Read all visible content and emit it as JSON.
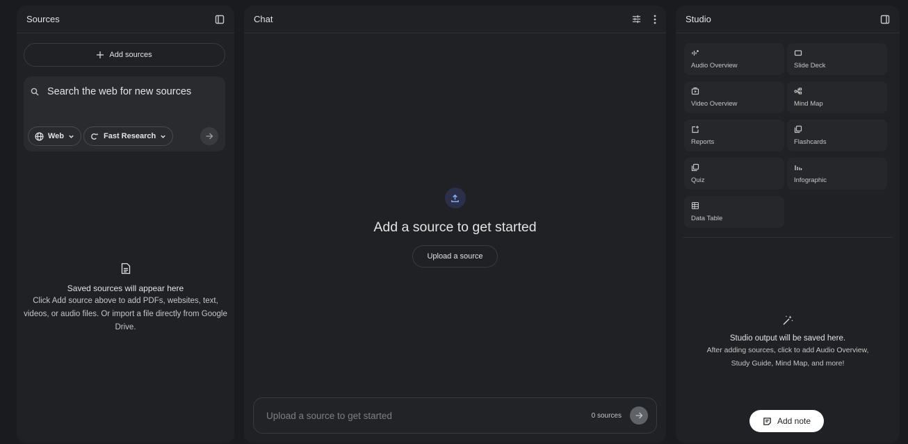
{
  "sources": {
    "title": "Sources",
    "add_label": "Add sources",
    "search_placeholder": "Search the web for new sources",
    "web_chip": "Web",
    "research_chip": "Fast Research",
    "empty_title": "Saved sources will appear here",
    "empty_desc": "Click Add source above to add PDFs, websites, text, videos, or audio files. Or import a file directly from Google Drive."
  },
  "chat": {
    "title": "Chat",
    "empty_title": "Add a source to get started",
    "upload_label": "Upload a source",
    "input_placeholder": "Upload a source to get started",
    "source_count": "0 sources"
  },
  "studio": {
    "title": "Studio",
    "tiles": [
      {
        "label": "Audio Overview",
        "icon": "audio-overview-icon"
      },
      {
        "label": "Slide Deck",
        "icon": "slide-deck-icon"
      },
      {
        "label": "Video Overview",
        "icon": "video-overview-icon"
      },
      {
        "label": "Mind Map",
        "icon": "mind-map-icon"
      },
      {
        "label": "Reports",
        "icon": "reports-icon"
      },
      {
        "label": "Flashcards",
        "icon": "flashcards-icon"
      },
      {
        "label": "Quiz",
        "icon": "quiz-icon"
      },
      {
        "label": "Infographic",
        "icon": "infographic-icon"
      },
      {
        "label": "Data Table",
        "icon": "data-table-icon"
      }
    ],
    "empty_title": "Studio output will be saved here.",
    "empty_desc_1": "After adding sources, click to add Audio Overview,",
    "empty_desc_2": "Study Guide, Mind Map, and more!",
    "add_note_label": "Add note"
  },
  "colors": {
    "background": "#1a1b1e",
    "panel": "#202124",
    "accent_upload": "#8ab4f8",
    "text_primary": "#e3e3e3",
    "text_muted": "#c4c7c5"
  }
}
